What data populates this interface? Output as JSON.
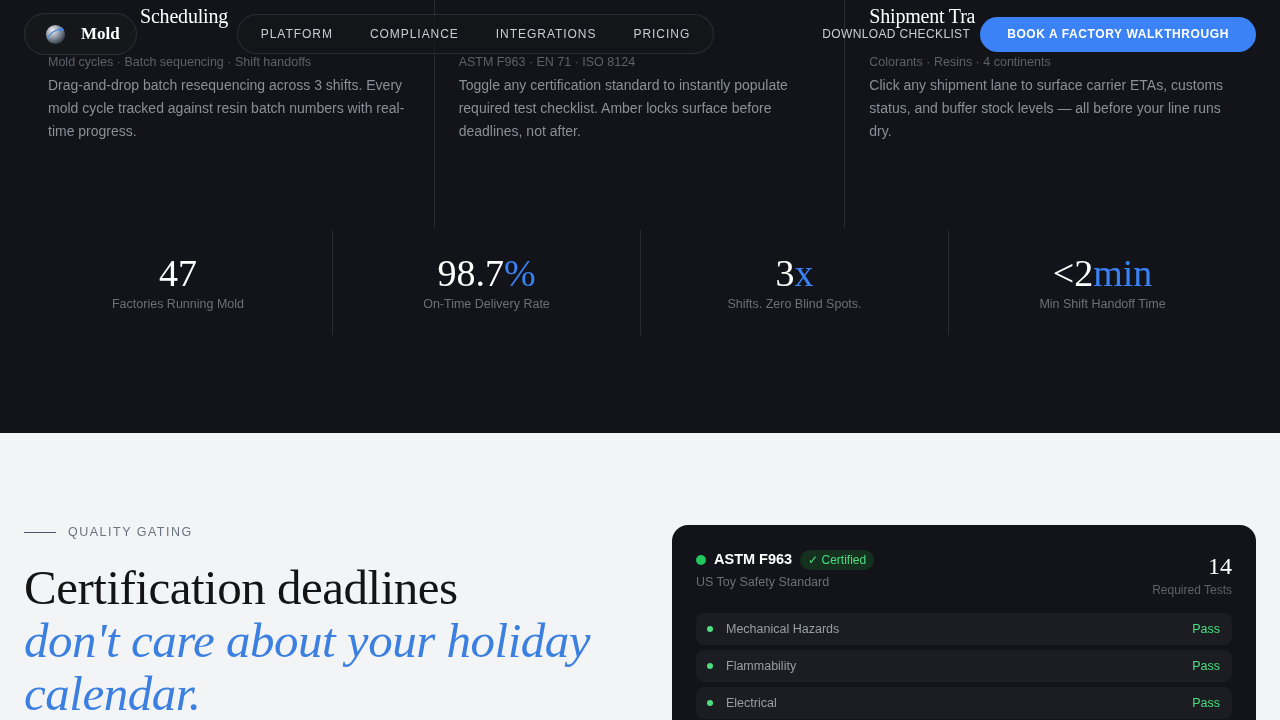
{
  "header": {
    "logo": "Mold",
    "nav": [
      {
        "label": "PLATFORM"
      },
      {
        "label": "COMPLIANCE"
      },
      {
        "label": "INTEGRATIONS"
      },
      {
        "label": "PRICING"
      }
    ],
    "link": "DOWNLOAD CHECKLIST",
    "cta": "BOOK A FACTORY WALKTHROUGH"
  },
  "features": [
    {
      "title": "Scheduling",
      "tags": "Mold cycles · Batch sequencing · Shift handoffs",
      "description": "Drag-and-drop batch resequencing across 3 shifts. Every mold cycle tracked against resin batch numbers with real-time progress."
    },
    {
      "tags": "ASTM F963 · EN 71 · ISO 8124",
      "description": "Toggle any certification standard to instantly populate required test checklist. Amber locks surface before deadlines, not after."
    },
    {
      "title": "Shipment Tra",
      "tags": "Colorants · Resins · 4 continents",
      "description": "Click any shipment lane to surface carrier ETAs, customs status, and buffer stock levels — all before your line runs dry."
    }
  ],
  "stats": [
    {
      "value": "47",
      "label": "Factories Running Mold"
    },
    {
      "value": "98.7",
      "suffix": "%",
      "label": "On-Time Delivery Rate"
    },
    {
      "value": "3",
      "suffix": "x",
      "label": "Shifts. Zero Blind Spots."
    },
    {
      "value": "<2",
      "suffix": "min",
      "label": "Min Shift Handoff Time"
    }
  ],
  "quality": {
    "eyebrow": "QUALITY GATING",
    "heading": "Certification deadlines",
    "heading_accent": "don't care about your holiday calendar."
  },
  "cert_card": {
    "standard": "ASTM F963",
    "color": "#22c55e",
    "badge": "✓ Certified",
    "subtitle": "US Toy Safety Standard",
    "count": "14",
    "count_label": "Required Tests",
    "tests": [
      {
        "name": "Mechanical Hazards",
        "result": "Pass",
        "color": "#4ade80"
      },
      {
        "name": "Flammability",
        "result": "Pass",
        "color": "#4ade80"
      },
      {
        "name": "Electrical",
        "result": "Pass",
        "color": "#4ade80"
      }
    ]
  }
}
